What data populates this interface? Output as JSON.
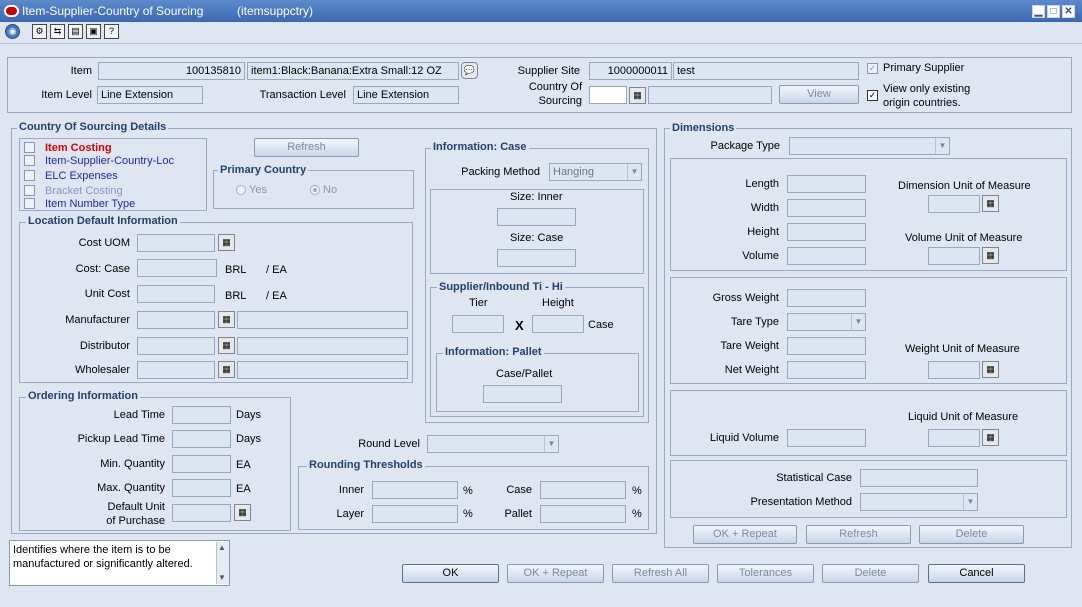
{
  "window": {
    "title": "Item-Supplier-Country of Sourcing",
    "form_name": "(itemsuppctry)",
    "minimize": "▁",
    "maximize": "□",
    "close": "✕"
  },
  "header": {
    "item_label": "Item",
    "item_number": "100135810",
    "item_desc": "item1:Black:Banana:Extra Small:12 OZ",
    "item_level_label": "Item Level",
    "item_level": "Line Extension",
    "transaction_level_label": "Transaction Level",
    "transaction_level": "Line Extension",
    "supplier_site_label": "Supplier Site",
    "supplier_site_number": "1000000011",
    "supplier_site_name": "test",
    "country_label_1": "Country Of",
    "country_label_2": "Sourcing",
    "country_value": "",
    "view_label": "View",
    "primary_supplier_label": "Primary Supplier",
    "view_only_label_1": "View only existing",
    "view_only_label_2": "origin countries."
  },
  "cos_details": {
    "title": "Country Of Sourcing Details",
    "nav_items": [
      {
        "label": "Item Costing",
        "color": "#e00000"
      },
      {
        "label": "Item-Supplier-Country-Loc",
        "color": "#1b2bb3"
      },
      {
        "label": "ELC Expenses",
        "color": "#1b2bb3"
      },
      {
        "label": "Bracket Costing",
        "color": "#8a95c6"
      },
      {
        "label": "Item Number Type",
        "color": "#1b2bb3"
      }
    ],
    "refresh_label": "Refresh",
    "primary_country_title": "Primary Country",
    "yes_label": "Yes",
    "no_label": "No"
  },
  "location_default": {
    "title": "Location Default Information",
    "cost_uom_label": "Cost UOM",
    "cost_case_label": "Cost: Case",
    "unit_cost_label": "Unit Cost",
    "currency": "BRL",
    "per_ea": "/ EA",
    "manufacturer_label": "Manufacturer",
    "distributor_label": "Distributor",
    "wholesaler_label": "Wholesaler"
  },
  "ordering": {
    "title": "Ordering Information",
    "lead_time_label": "Lead Time",
    "pickup_lead_time_label": "Pickup Lead Time",
    "days": "Days",
    "min_qty_label": "Min. Quantity",
    "max_qty_label": "Max. Quantity",
    "ea": "EA",
    "default_unit_label_1": "Default Unit",
    "default_unit_label_2": "of Purchase"
  },
  "info_case": {
    "title": "Information: Case",
    "packing_method_label": "Packing Method",
    "packing_method_value": "Hanging",
    "size_inner_label": "Size: Inner",
    "size_case_label": "Size: Case"
  },
  "ti_hi": {
    "title": "Supplier/Inbound Ti - Hi",
    "tier_label": "Tier",
    "height_label": "Height",
    "x_label": "X",
    "case_label": "Case",
    "pallet_title": "Information: Pallet",
    "case_pallet_label": "Case/Pallet"
  },
  "rounding": {
    "round_level_label": "Round Level",
    "title": "Rounding Thresholds",
    "inner_label": "Inner",
    "layer_label": "Layer",
    "case_label": "Case",
    "pallet_label": "Pallet",
    "pct": "%"
  },
  "dimensions": {
    "title": "Dimensions",
    "package_type_label": "Package Type",
    "length_label": "Length",
    "width_label": "Width",
    "height_label": "Height",
    "volume_label": "Volume",
    "dim_uom_label": "Dimension Unit of Measure",
    "vol_uom_label": "Volume Unit of Measure",
    "gross_weight_label": "Gross Weight",
    "tare_type_label": "Tare Type",
    "tare_weight_label": "Tare Weight",
    "net_weight_label": "Net Weight",
    "weight_uom_label": "Weight Unit of Measure",
    "liquid_uom_label": "Liquid Unit of Measure",
    "liquid_volume_label": "Liquid Volume",
    "statistical_case_label": "Statistical Case",
    "presentation_method_label": "Presentation Method",
    "ok_repeat": "OK + Repeat",
    "refresh": "Refresh",
    "delete": "Delete"
  },
  "hint": {
    "text": "Identifies where the item is to be manufactured or significantly altered."
  },
  "footer": {
    "ok": "OK",
    "ok_repeat": "OK + Repeat",
    "refresh_all": "Refresh All",
    "tolerances": "Tolerances",
    "delete": "Delete",
    "cancel": "Cancel"
  }
}
